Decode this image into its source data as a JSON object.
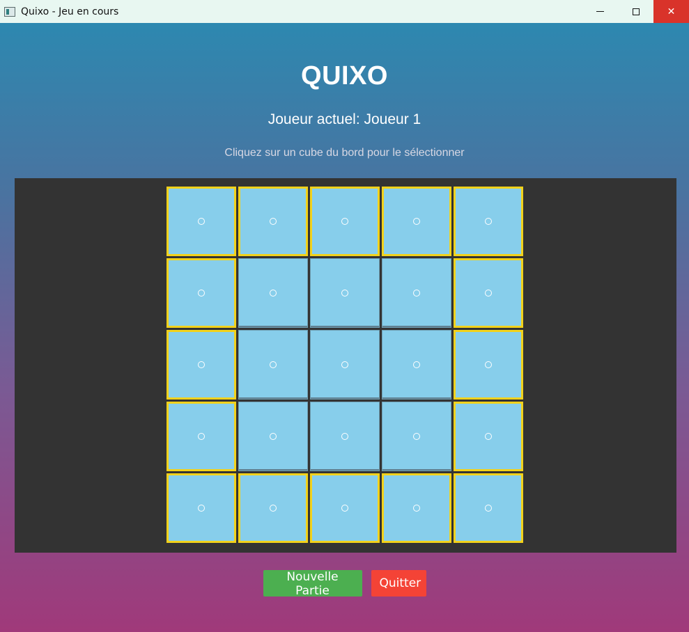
{
  "window": {
    "title": "Quixo - Jeu en cours",
    "close_glyph": "✕"
  },
  "game": {
    "title": "QUIXO",
    "current_player": "Joueur actuel: Joueur 1",
    "instruction": "Cliquez sur un cube du bord pour le sélectionner"
  },
  "board": {
    "size": 5,
    "cell_symbol": "circle-empty",
    "cell_color": "#87ceeb",
    "edge_highlight_color": "#f2d21b",
    "panel_color": "#333333"
  },
  "buttons": {
    "new_game": "Nouvelle Partie",
    "quit": "Quitter"
  },
  "colors": {
    "new_game_button": "#4caf50",
    "quit_button": "#f44336",
    "close_button": "#d9332a"
  }
}
